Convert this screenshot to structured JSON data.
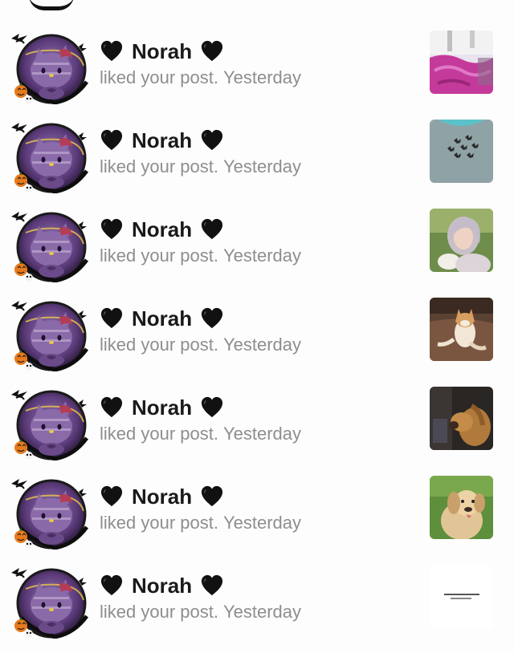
{
  "notifications": [
    {
      "user": "Norah",
      "prefix_icon": "black-heart",
      "suffix_icon": "black-heart",
      "action": "liked your post.",
      "time": "Yesterday",
      "thumb": "pink-bedding"
    },
    {
      "user": "Norah",
      "prefix_icon": "black-heart",
      "suffix_icon": "black-heart",
      "action": "liked your post.",
      "time": "Yesterday",
      "thumb": "butterfly-shirt"
    },
    {
      "user": "Norah",
      "prefix_icon": "black-heart",
      "suffix_icon": "black-heart",
      "action": "liked your post.",
      "time": "Yesterday",
      "thumb": "selfie-with-cat"
    },
    {
      "user": "Norah",
      "prefix_icon": "black-heart",
      "suffix_icon": "black-heart",
      "action": "liked your post.",
      "time": "Yesterday",
      "thumb": "shiba-dog"
    },
    {
      "user": "Norah",
      "prefix_icon": "black-heart",
      "suffix_icon": "black-heart",
      "action": "liked your post.",
      "time": "Yesterday",
      "thumb": "golden-dog-dark"
    },
    {
      "user": "Norah",
      "prefix_icon": "black-heart",
      "suffix_icon": "black-heart",
      "action": "liked your post.",
      "time": "Yesterday",
      "thumb": "golden-retriever-grass"
    },
    {
      "user": "Norah",
      "prefix_icon": "black-heart",
      "suffix_icon": "black-heart",
      "action": "liked your post.",
      "time": "Yesterday",
      "thumb": "text-post"
    }
  ],
  "colors": {
    "name": "#1a1a1a",
    "meta": "#8e8e8e",
    "avatar_bg": "#5a3a78",
    "background": "#fdfdfd"
  }
}
